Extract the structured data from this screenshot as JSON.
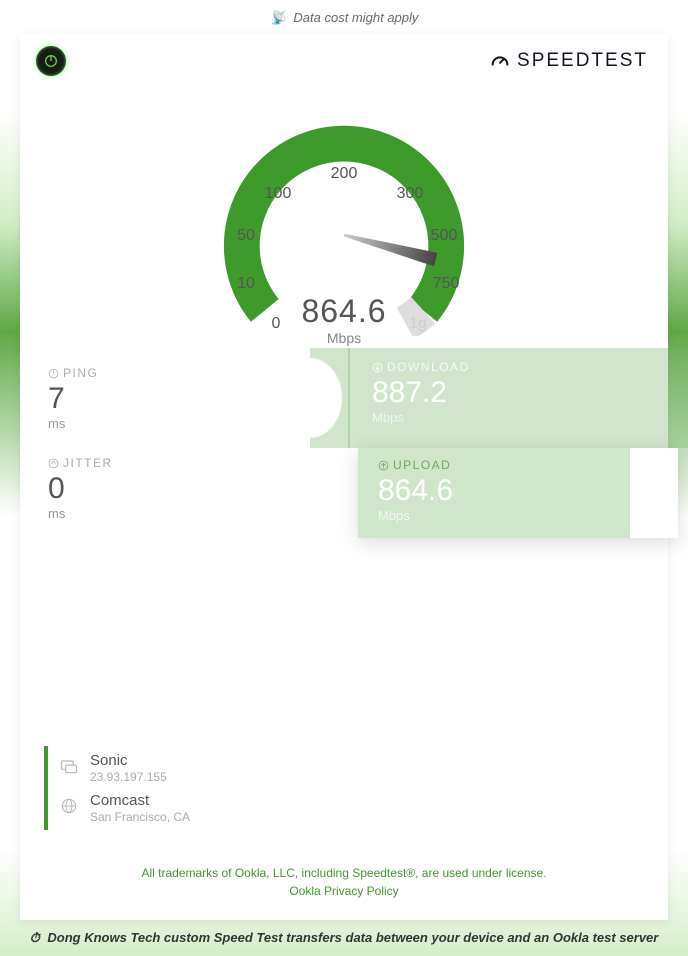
{
  "top_banner": {
    "text": "Data cost might apply",
    "icon": "📡"
  },
  "brand": {
    "label": "SPEEDTEST"
  },
  "gauge": {
    "value": "864.6",
    "unit": "Mbps",
    "ticks": [
      "0",
      "10",
      "50",
      "100",
      "200",
      "300",
      "500",
      "750",
      "1g"
    ]
  },
  "ping": {
    "label": "PING",
    "value": "7",
    "unit": "ms"
  },
  "jitter": {
    "label": "JITTER",
    "value": "0",
    "unit": "ms"
  },
  "download": {
    "label": "DOWNLOAD",
    "value": "887.2",
    "unit": "Mbps"
  },
  "upload": {
    "label": "UPLOAD",
    "value": "864.6",
    "unit": "Mbps"
  },
  "providers": {
    "isp": {
      "name": "Sonic",
      "sub": "23.93.197.155"
    },
    "server": {
      "name": "Comcast",
      "sub": "San Francisco, CA"
    }
  },
  "footer": {
    "line1": "All trademarks of Ookla, LLC, including Speedtest®, are used under license.",
    "line2": "Ookla Privacy Policy"
  },
  "bottom_banner": {
    "icon": "⏱",
    "text": "Dong Knows Tech custom Speed Test transfers data between your device and an Ookla test server"
  },
  "chart_data": {
    "type": "gauge",
    "value": 864.6,
    "unit": "Mbps",
    "ticks": [
      0,
      10,
      50,
      100,
      200,
      300,
      500,
      750,
      1000
    ],
    "tick_labels": [
      "0",
      "10",
      "50",
      "100",
      "200",
      "300",
      "500",
      "750",
      "1g"
    ],
    "range": [
      0,
      1000
    ]
  }
}
